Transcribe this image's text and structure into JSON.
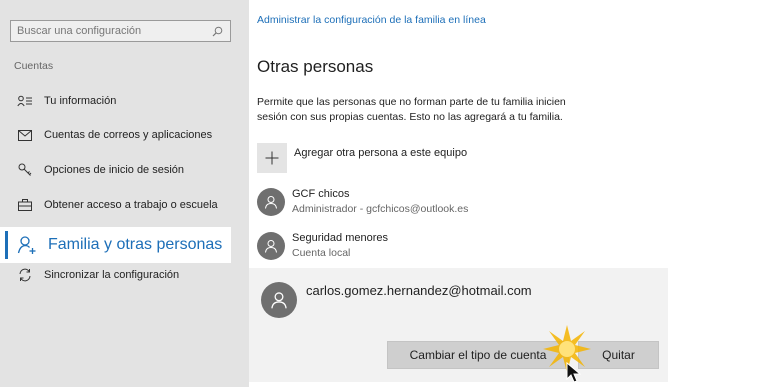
{
  "sidebar": {
    "search_placeholder": "Buscar una configuración",
    "section_label": "Cuentas",
    "items": [
      {
        "label": "Tu información",
        "icon": "person-info-icon"
      },
      {
        "label": "Cuentas de correos y aplicaciones",
        "icon": "mail-icon"
      },
      {
        "label": "Opciones de inicio de sesión",
        "icon": "key-icon"
      },
      {
        "label": "Obtener acceso a trabajo o escuela",
        "icon": "briefcase-icon"
      },
      {
        "label": "Familia y otras personas",
        "icon": "add-person-icon",
        "active": true
      },
      {
        "label": "Sincronizar la configuración",
        "icon": "sync-icon"
      }
    ]
  },
  "main": {
    "top_link": "Administrar la configuración de la familia en línea",
    "title": "Otras personas",
    "description": "Permite que las personas que no forman parte de tu familia inicien sesión con sus propias cuentas. Esto no las agregará a tu familia.",
    "add_label": "Agregar otra persona a este equipo",
    "people": [
      {
        "name": "GCF chicos",
        "subtitle": "Administrador - gcfchicos@outlook.es"
      },
      {
        "name": "Seguridad menores",
        "subtitle": "Cuenta local"
      }
    ],
    "expanded": {
      "email": "carlos.gomez.hernandez@hotmail.com",
      "change_button": "Cambiar el tipo de cuenta",
      "remove_button": "Quitar"
    }
  },
  "colors": {
    "accent": "#1d6fb8",
    "sidebar_bg": "#e3e3e3",
    "highlight": "#f5b400"
  }
}
